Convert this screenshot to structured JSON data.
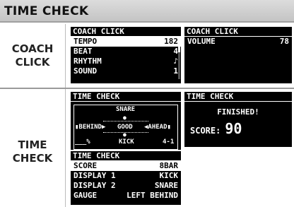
{
  "page": {
    "title": "TIME CHECK"
  },
  "sections": {
    "coach_click": "COACH\nCLICK",
    "time_check": "TIME\nCHECK"
  },
  "coach_click_screen": {
    "header": "COACH CLICK",
    "rows": [
      {
        "label": "TEMPO",
        "value": "182",
        "selected": true
      },
      {
        "label": "BEAT",
        "value": "4",
        "selected": false
      },
      {
        "label": "RHYTHM",
        "value": "♪",
        "selected": false
      },
      {
        "label": "SOUND",
        "value": "1",
        "selected": false
      }
    ]
  },
  "volume_screen": {
    "header": "COACH CLICK",
    "label": "VOLUME",
    "value": "78"
  },
  "gauge_screen": {
    "header": "TIME CHECK",
    "snare": "SNARE",
    "kick": "KICK",
    "behind": "BEHIND",
    "good": "GOOD",
    "ahead": "AHEAD",
    "percent": "___%",
    "measure": "4-1"
  },
  "finished_screen": {
    "header": "TIME CHECK",
    "message": "FINISHED!",
    "score_label": "SCORE:",
    "score_value": "90"
  },
  "settings_screen": {
    "header": "TIME CHECK",
    "rows": [
      {
        "label": "SCORE",
        "value": "8BAR",
        "selected": true
      },
      {
        "label": "DISPLAY 1",
        "value": "KICK",
        "selected": false
      },
      {
        "label": "DISPLAY 2",
        "value": "SNARE",
        "selected": false
      },
      {
        "label": "GAUGE",
        "value": "LEFT BEHIND",
        "selected": false
      }
    ]
  }
}
